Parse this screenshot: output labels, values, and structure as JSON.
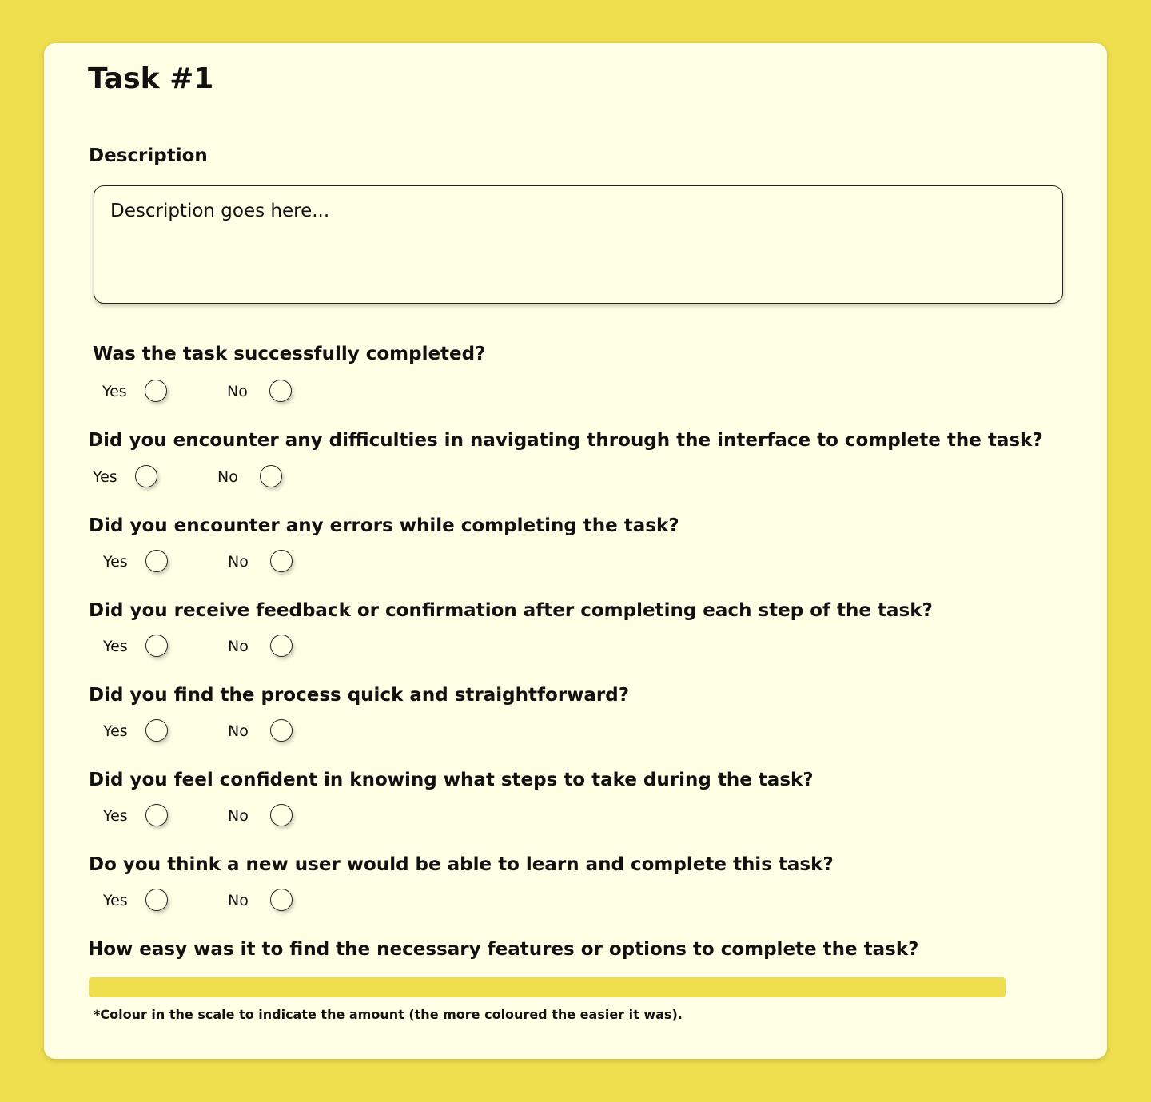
{
  "page": {
    "title": "Task #1"
  },
  "description": {
    "label": "Description",
    "placeholder": "Description goes here..."
  },
  "questions": [
    {
      "text": "Was the task successfully completed?",
      "yes_label": "Yes",
      "no_label": "No"
    },
    {
      "text": "Did you encounter any difficulties in navigating through the interface to complete the task?",
      "yes_label": "Yes",
      "no_label": "No"
    },
    {
      "text": "Did you encounter any errors while completing the task?",
      "yes_label": "Yes",
      "no_label": "No"
    },
    {
      "text": "Did you receive feedback or confirmation after completing each step of the task?",
      "yes_label": "Yes",
      "no_label": "No"
    },
    {
      "text": "Did you find the process quick and straightforward?",
      "yes_label": "Yes",
      "no_label": "No"
    },
    {
      "text": "Did you feel confident in knowing what steps to take during the task?",
      "yes_label": "Yes",
      "no_label": "No"
    },
    {
      "text": "Do you think a new user would be able to learn and complete this task?",
      "yes_label": "Yes",
      "no_label": "No"
    }
  ],
  "scale": {
    "question": "How easy was it to find the necessary features or options to complete the task?",
    "note": "*Colour in the scale to indicate the amount (the more coloured the easier it was).",
    "fill_fraction": 0,
    "track_color": "#EFDF4F",
    "fill_color": "#D9C52A"
  },
  "colors": {
    "background": "#EFDF4F",
    "card": "#FFFFE5",
    "text": "#111111"
  }
}
